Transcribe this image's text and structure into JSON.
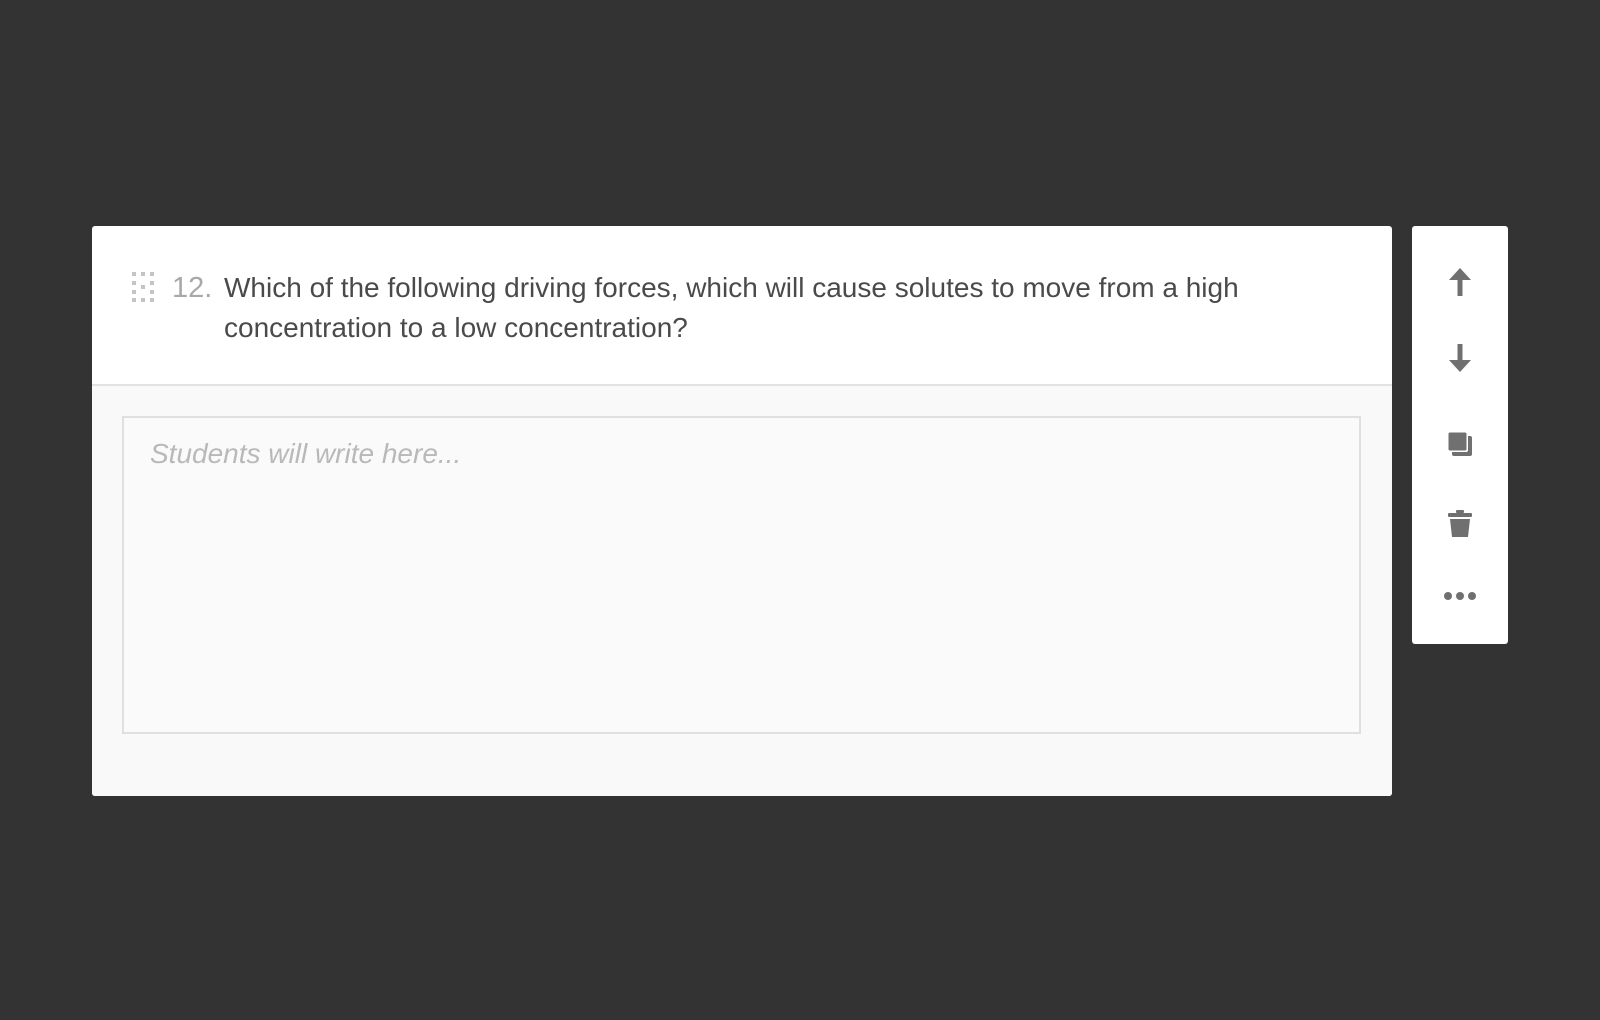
{
  "question": {
    "number": "12.",
    "text": "Which of the following driving forces, which will cause solutes to move from a high concentration to a low concentration?"
  },
  "answer": {
    "placeholder": "Students will write here..."
  },
  "toolbar": {
    "items": [
      {
        "icon": "arrow-up-icon"
      },
      {
        "icon": "arrow-down-icon"
      },
      {
        "icon": "duplicate-icon"
      },
      {
        "icon": "trash-icon"
      },
      {
        "icon": "more-options-icon"
      }
    ]
  },
  "colors": {
    "background": "#333333",
    "card": "#ffffff",
    "icon": "#707070",
    "text": "#4a4a4a",
    "muted": "#a8a8a8"
  }
}
